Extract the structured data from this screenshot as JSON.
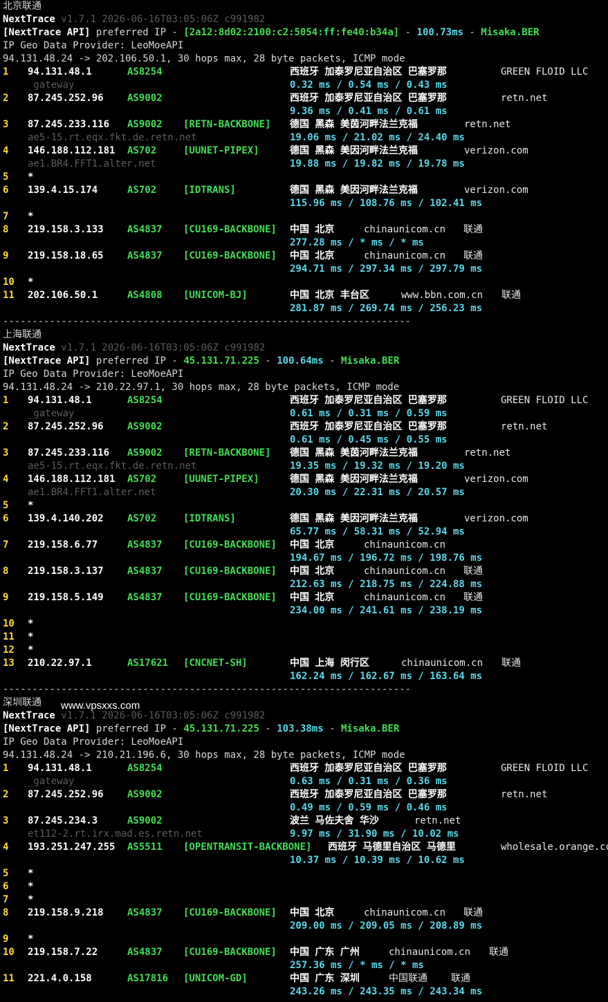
{
  "watermark": "www.vpsxxs.com",
  "separator": "----------------------------------------------------------------------",
  "tool": {
    "name": "NextTrace",
    "version": "v1.7.1 2026-06-16T03:05:06Z c991982"
  },
  "api": {
    "tag": "[NextTrace API]",
    "text": "preferred IP -",
    "dash": "-"
  },
  "geo_line": "IP Geo Data Provider: LeoMoeAPI",
  "sections": [
    {
      "title": "北京联通",
      "api_ip": "[2a12:8d02:2100:c2:5054:ff:fe40:b34a]",
      "api_ms": "100.73ms",
      "api_node": "Misaka.BER",
      "route": "94.131.48.24 -> 202.106.50.1, 30 hops max, 28 byte packets, ICMP mode",
      "hops": [
        {
          "n": "1",
          "ip": "94.131.48.1",
          "as": "AS8254",
          "geo": "西班牙 加泰罗尼亚自治区 巴塞罗那",
          "host": "GREEN FLOID LLC",
          "rdns": "_gateway",
          "rtt": "0.32 ms / 0.54 ms / 0.43 ms"
        },
        {
          "n": "2",
          "ip": "87.245.252.96",
          "as": "AS9002",
          "geo": "西班牙 加泰罗尼亚自治区 巴塞罗那",
          "host": "retn.net",
          "rtt": "9.36 ms / 0.41 ms / 0.61 ms"
        },
        {
          "n": "3",
          "ip": "87.245.233.116",
          "as": "AS9002",
          "tag": "[RETN-BACKBONE]",
          "geo": "德国 黑森 美茵河畔法兰克福",
          "host": "retn.net",
          "rdns": "ae5-15.rt.eqx.fkt.de.retn.net",
          "rtt": "19.06 ms / 21.02 ms / 24.40 ms"
        },
        {
          "n": "4",
          "ip": "146.188.112.181",
          "as": "AS702",
          "tag": "[UUNET-PIPEX]",
          "geo": "德国 黑森 美因河畔法兰克福",
          "host": "verizon.com",
          "rdns": "ae1.BR4.FFT1.alter.net",
          "rtt": "19.88 ms / 19.82 ms / 19.78 ms"
        },
        {
          "n": "5",
          "star": true
        },
        {
          "n": "6",
          "ip": "139.4.15.174",
          "as": "AS702",
          "tag": "[IDTRANS]",
          "geo": "德国 黑森 美因河畔法兰克福",
          "host": "verizon.com",
          "rtt": "115.96 ms / 108.76 ms / 102.41 ms"
        },
        {
          "n": "7",
          "star": true
        },
        {
          "n": "8",
          "ip": "219.158.3.133",
          "as": "AS4837",
          "tag": "[CU169-BACKBONE]",
          "geo": "中国 北京",
          "host": "chinaunicom.cn",
          "isp": "联通",
          "rtt": "277.28 ms / * ms / * ms"
        },
        {
          "n": "9",
          "ip": "219.158.18.65",
          "as": "AS4837",
          "tag": "[CU169-BACKBONE]",
          "geo": "中国 北京",
          "host": "chinaunicom.cn",
          "isp": "联通",
          "rtt": "294.71 ms / 297.34 ms / 297.79 ms"
        },
        {
          "n": "10",
          "star": true
        },
        {
          "n": "11",
          "ip": "202.106.50.1",
          "as": "AS4808",
          "tag": "[UNICOM-BJ]",
          "geo": "中国 北京 丰台区",
          "host": "www.bbn.com.cn",
          "isp": "联通",
          "rtt": "281.87 ms / 269.74 ms / 256.23 ms"
        }
      ]
    },
    {
      "title": "上海联通",
      "api_ip": "45.131.71.225",
      "api_ms": "100.64ms",
      "api_node": "Misaka.BER",
      "route": "94.131.48.24 -> 210.22.97.1, 30 hops max, 28 byte packets, ICMP mode",
      "hops": [
        {
          "n": "1",
          "ip": "94.131.48.1",
          "as": "AS8254",
          "geo": "西班牙 加泰罗尼亚自治区 巴塞罗那",
          "host": "GREEN FLOID LLC",
          "rdns": "_gateway",
          "rtt": "0.61 ms / 0.31 ms / 0.59 ms"
        },
        {
          "n": "2",
          "ip": "87.245.252.96",
          "as": "AS9002",
          "geo": "西班牙 加泰罗尼亚自治区 巴塞罗那",
          "host": "retn.net",
          "rtt": "0.61 ms / 0.45 ms / 0.55 ms"
        },
        {
          "n": "3",
          "ip": "87.245.233.116",
          "as": "AS9002",
          "tag": "[RETN-BACKBONE]",
          "geo": "德国 黑森 美茵河畔法兰克福",
          "host": "retn.net",
          "rdns": "ae5-15.rt.eqx.fkt.de.retn.net",
          "rtt": "19.35 ms / 19.32 ms / 19.20 ms"
        },
        {
          "n": "4",
          "ip": "146.188.112.181",
          "as": "AS702",
          "tag": "[UUNET-PIPEX]",
          "geo": "德国 黑森 美因河畔法兰克福",
          "host": "verizon.com",
          "rdns": "ae1.BR4.FFT1.alter.net",
          "rtt": "20.30 ms / 22.31 ms / 20.57 ms"
        },
        {
          "n": "5",
          "star": true
        },
        {
          "n": "6",
          "ip": "139.4.140.202",
          "as": "AS702",
          "tag": "[IDTRANS]",
          "geo": "德国 黑森 美因河畔法兰克福",
          "host": "verizon.com",
          "rtt": "65.77 ms / 58.31 ms / 52.94 ms"
        },
        {
          "n": "7",
          "ip": "219.158.6.77",
          "as": "AS4837",
          "tag": "[CU169-BACKBONE]",
          "geo": "中国 北京",
          "host": "chinaunicom.cn",
          "rtt": "194.67 ms / 196.72 ms / 198.76 ms"
        },
        {
          "n": "8",
          "ip": "219.158.3.137",
          "as": "AS4837",
          "tag": "[CU169-BACKBONE]",
          "geo": "中国 北京",
          "host": "chinaunicom.cn",
          "isp": "联通",
          "rtt": "212.63 ms / 218.75 ms / 224.88 ms"
        },
        {
          "n": "9",
          "ip": "219.158.5.149",
          "as": "AS4837",
          "tag": "[CU169-BACKBONE]",
          "geo": "中国 北京",
          "host": "chinaunicom.cn",
          "isp": "联通",
          "rtt": "234.00 ms / 241.61 ms / 238.19 ms"
        },
        {
          "n": "10",
          "star": true
        },
        {
          "n": "11",
          "star": true
        },
        {
          "n": "12",
          "star": true
        },
        {
          "n": "13",
          "ip": "210.22.97.1",
          "as": "AS17621",
          "tag": "[CNCNET-SH]",
          "geo": "中国 上海 闵行区",
          "host": "chinaunicom.cn",
          "isp": "联通",
          "rtt": "162.24 ms / 162.67 ms / 163.64 ms"
        }
      ]
    },
    {
      "title": "深圳联通",
      "api_ip": "45.131.71.225",
      "api_ms": "103.38ms",
      "api_node": "Misaka.BER",
      "route": "94.131.48.24 -> 210.21.196.6, 30 hops max, 28 byte packets, ICMP mode",
      "hops": [
        {
          "n": "1",
          "ip": "94.131.48.1",
          "as": "AS8254",
          "geo": "西班牙 加泰罗尼亚自治区 巴塞罗那",
          "host": "GREEN FLOID LLC",
          "rdns": "_gateway",
          "rtt": "0.63 ms / 0.31 ms / 0.36 ms"
        },
        {
          "n": "2",
          "ip": "87.245.252.96",
          "as": "AS9002",
          "geo": "西班牙 加泰罗尼亚自治区 巴塞罗那",
          "host": "retn.net",
          "rtt": "0.49 ms / 0.59 ms / 0.46 ms"
        },
        {
          "n": "3",
          "ip": "87.245.234.3",
          "as": "AS9002",
          "geo": "波兰 马佐夫舍 华沙",
          "host": "retn.net",
          "rdns": "et112-2.rt.irx.mad.es.retn.net",
          "rtt": "9.97 ms / 31.90 ms / 10.02 ms"
        },
        {
          "n": "4",
          "ip": "193.251.247.255",
          "as": "AS5511",
          "tag": "[OPENTRANSIT-BACKBONE]",
          "geo": "西班牙 马德里自治区 马德里",
          "host": "wholesale.orange.com",
          "rtt": "10.37 ms / 10.39 ms / 10.62 ms"
        },
        {
          "n": "5",
          "star": true
        },
        {
          "n": "6",
          "star": true
        },
        {
          "n": "7",
          "star": true
        },
        {
          "n": "8",
          "ip": "219.158.9.218",
          "as": "AS4837",
          "tag": "[CU169-BACKBONE]",
          "geo": "中国 北京",
          "host": "chinaunicom.cn",
          "isp": "联通",
          "rtt": "209.00 ms / 209.05 ms / 208.89 ms"
        },
        {
          "n": "9",
          "star": true
        },
        {
          "n": "10",
          "ip": "219.158.7.22",
          "as": "AS4837",
          "tag": "[CU169-BACKBONE]",
          "geo": "中国 广东 广州",
          "host": "chinaunicom.cn",
          "isp": "联通",
          "rtt": "257.36 ms / * ms / * ms"
        },
        {
          "n": "11",
          "ip": "221.4.0.158",
          "as": "AS17816",
          "tag": "[UNICOM-GD]",
          "geo": "中国 广东 深圳",
          "host": "中国联通",
          "isp": "联通",
          "rtt": "243.26 ms / 243.35 ms / 243.34 ms"
        }
      ]
    }
  ]
}
